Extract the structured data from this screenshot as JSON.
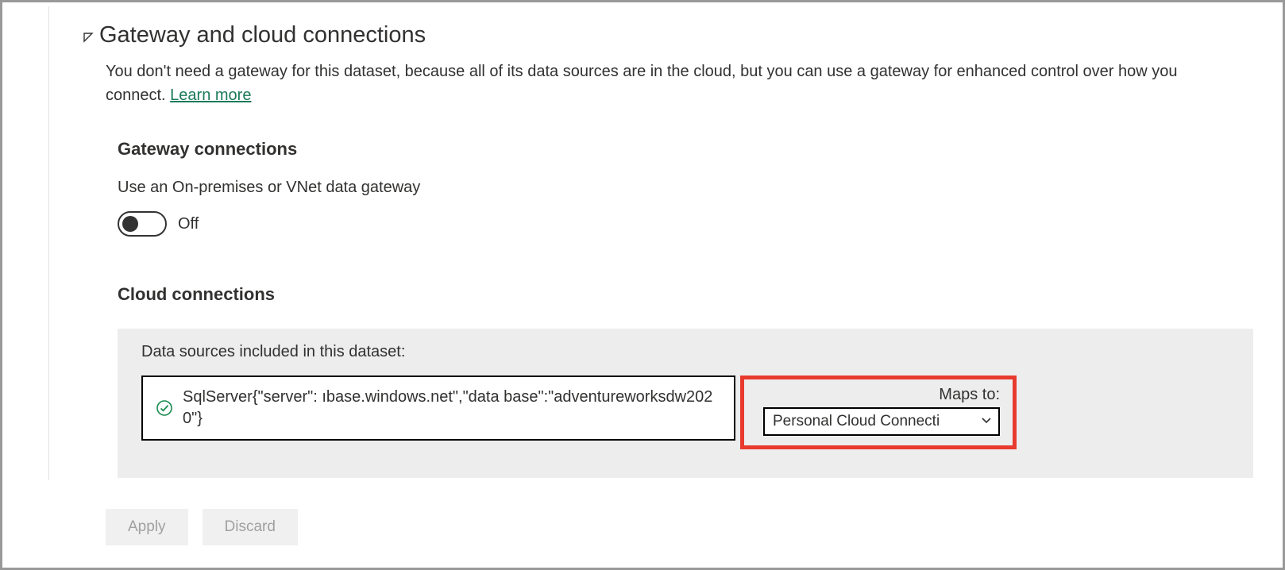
{
  "section": {
    "title": "Gateway and cloud connections",
    "description_pre": "You don't need a gateway for this dataset, because all of its data sources are in the cloud, but you can use a gateway for enhanced control over how you connect. ",
    "learn_more": "Learn more"
  },
  "gateway": {
    "heading": "Gateway connections",
    "toggle_label": "Use an On-premises or VNet data gateway",
    "toggle_state": "Off"
  },
  "cloud": {
    "heading": "Cloud connections",
    "panel_label": "Data sources included in this dataset:",
    "datasource_text": "SqlServer{\"server\":                          ıbase.windows.net\",\"data base\":\"adventureworksdw2020\"}",
    "maps_to_label": "Maps to:",
    "dropdown_value": "Personal Cloud Connecti"
  },
  "footer": {
    "apply": "Apply",
    "discard": "Discard"
  }
}
